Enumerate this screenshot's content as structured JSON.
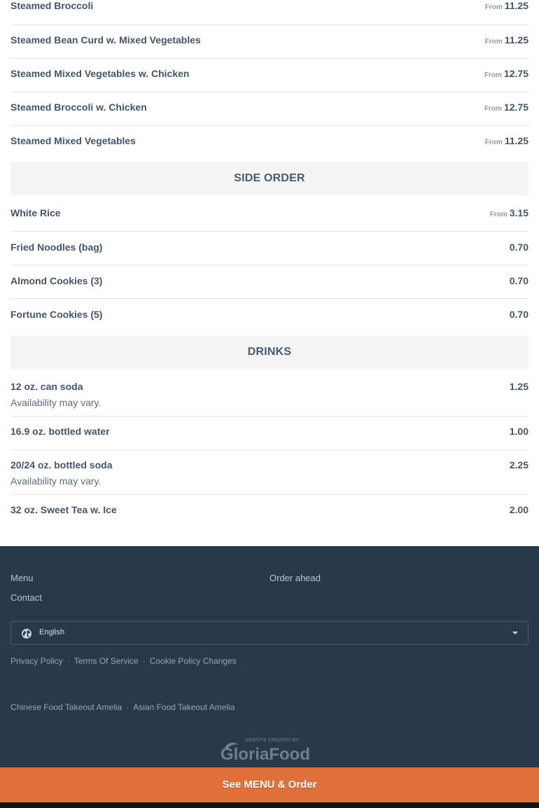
{
  "menu": {
    "from_label": "From",
    "steamed": [
      {
        "name": "Steamed Broccoli",
        "price": "11.25",
        "from": true
      },
      {
        "name": "Steamed Bean Curd w. Mixed Vegetables",
        "price": "11.25",
        "from": true
      },
      {
        "name": "Steamed Mixed Vegetables w. Chicken",
        "price": "12.75",
        "from": true
      },
      {
        "name": "Steamed Broccoli w. Chicken",
        "price": "12.75",
        "from": true
      },
      {
        "name": "Steamed Mixed Vegetables",
        "price": "11.25",
        "from": true
      }
    ],
    "side_order": {
      "title": "SIDE ORDER",
      "items": [
        {
          "name": "White Rice",
          "price": "3.15",
          "from": true
        },
        {
          "name": "Fried Noodles (bag)",
          "price": "0.70",
          "from": false
        },
        {
          "name": "Almond Cookies (3)",
          "price": "0.70",
          "from": false
        },
        {
          "name": "Fortune Cookies (5)",
          "price": "0.70",
          "from": false
        }
      ]
    },
    "drinks": {
      "title": "DRINKS",
      "items": [
        {
          "name": "12 oz. can soda",
          "price": "1.25",
          "desc": "Availability may vary."
        },
        {
          "name": "16.9 oz. bottled water",
          "price": "1.00"
        },
        {
          "name": "20/24 oz. bottled soda",
          "price": "2.25",
          "desc": "Availability may vary."
        },
        {
          "name": "32 oz. Sweet Tea w. Ice",
          "price": "2.00"
        }
      ]
    }
  },
  "footer": {
    "links": {
      "menu": "Menu",
      "order_ahead": "Order ahead",
      "contact": "Contact"
    },
    "language": "English",
    "legal": [
      "Privacy Policy",
      "Terms Of Service",
      "Cookie Policy Changes"
    ],
    "seo": [
      "Chinese Food Takeout Amelia",
      "Asian Food Takeout Amelia"
    ],
    "brand": {
      "tagline": "WEBSITE CREATED BY",
      "name": "GloriaFood"
    }
  },
  "cta": {
    "label": "See MENU & Order"
  },
  "colors": {
    "footer_bg": "#27394b",
    "cta_bg": "#e0703a",
    "section_bg": "#f4f4f4",
    "text": "#44546a"
  }
}
